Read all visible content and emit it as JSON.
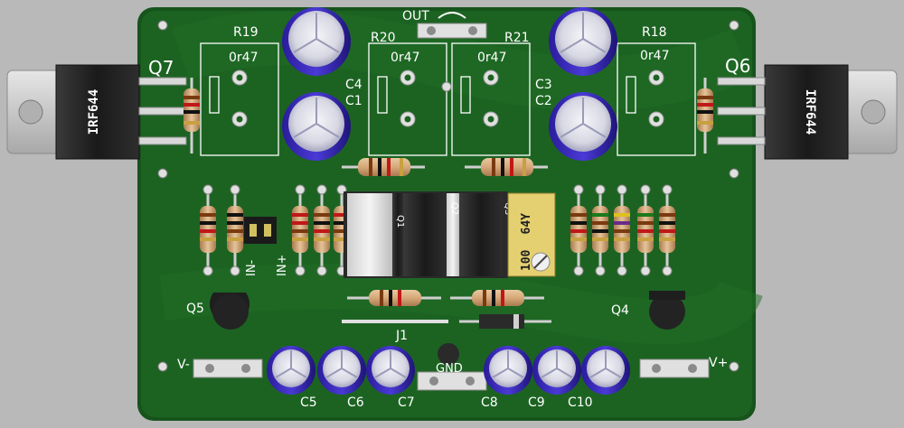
{
  "board": {
    "top_label": "OUT",
    "gnd_label": "GND",
    "j1_label": "J1",
    "in_minus": "IN-",
    "in_plus": "IN+",
    "v_minus": "V-",
    "v_plus": "V+"
  },
  "mosfets": {
    "q7": {
      "ref": "Q7",
      "part": "IRF644"
    },
    "q6": {
      "ref": "Q6",
      "part": "IRF644"
    }
  },
  "resistors": {
    "r19": {
      "ref": "R19",
      "value": "0r47"
    },
    "r20": {
      "ref": "R20",
      "value": "0r47"
    },
    "r21": {
      "ref": "R21",
      "value": "0r47"
    },
    "r18": {
      "ref": "R18",
      "value": "0r47"
    }
  },
  "caps_top": {
    "c4": "C4",
    "c1": "C1",
    "c3": "C3",
    "c2": "C2"
  },
  "caps_bottom": [
    "C5",
    "C6",
    "C7",
    "C8",
    "C9",
    "C10"
  ],
  "transistors": {
    "q5": "Q5",
    "q4": "Q4"
  },
  "trimmer": {
    "code": "64Y",
    "value": "100"
  },
  "to220_marks": [
    "Q1",
    "Q2",
    "Q3"
  ]
}
